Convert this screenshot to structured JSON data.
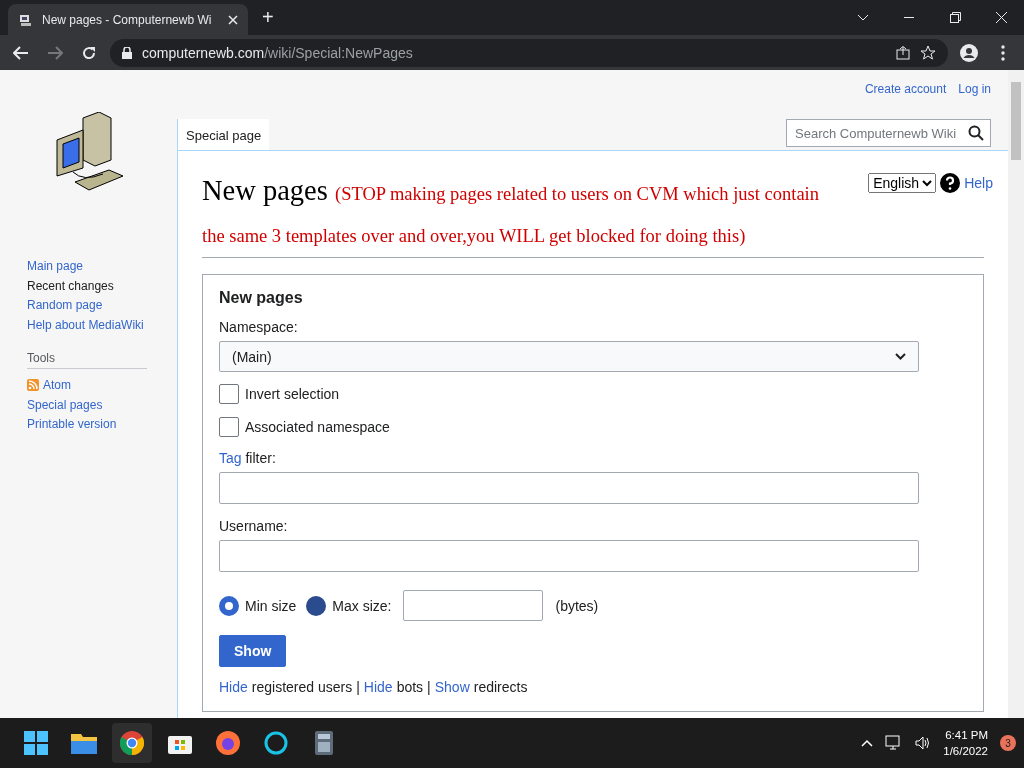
{
  "browser": {
    "tab_title": "New pages - Computernewb Wi",
    "new_tab": "+",
    "url_host": "computernewb.com",
    "url_path": "/wiki/Special:NewPages"
  },
  "personal": [
    "Create account",
    "Log in"
  ],
  "page_tab": {
    "label": "Special page",
    "selected": true
  },
  "search": {
    "placeholder": "Search Computernewb Wiki"
  },
  "sidebar": {
    "nav": [
      "Main page",
      "Recent changes",
      "Random page",
      "Help about MediaWiki"
    ],
    "tools_heading": "Tools",
    "tools": [
      {
        "label": "Atom",
        "kind": "feed"
      },
      {
        "label": "Special pages",
        "kind": "link"
      },
      {
        "label": "Printable version",
        "kind": "link"
      }
    ]
  },
  "heading": {
    "title": "New pages",
    "note": "(STOP making pages related to users on CVM which just contain the same 3 templates over and over,you WILL get blocked for doing this)"
  },
  "language": {
    "value": "English"
  },
  "help": "Help",
  "form": {
    "legend": "New pages",
    "namespace_label": "Namespace:",
    "namespace_value": "(Main)",
    "checkboxes": [
      {
        "label": "Invert selection",
        "checked": false
      },
      {
        "label": "Associated namespace",
        "checked": false
      }
    ],
    "tag_link": "Tag",
    "tag_label": " filter:",
    "username_label": "Username:",
    "size_options": [
      {
        "label": "Min size",
        "selected": true
      },
      {
        "label": "Max size:",
        "selected": false
      }
    ],
    "bytes": "(bytes)",
    "submit": "Show",
    "filters": [
      {
        "link": "Hide",
        "text": "registered users"
      },
      {
        "link": "Hide",
        "text": "bots"
      },
      {
        "link": "Show",
        "text": "redirects"
      }
    ],
    "separator": "|"
  },
  "taskbar": {
    "time": "6:41 PM",
    "date": "1/6/2022",
    "notifications": "3"
  }
}
